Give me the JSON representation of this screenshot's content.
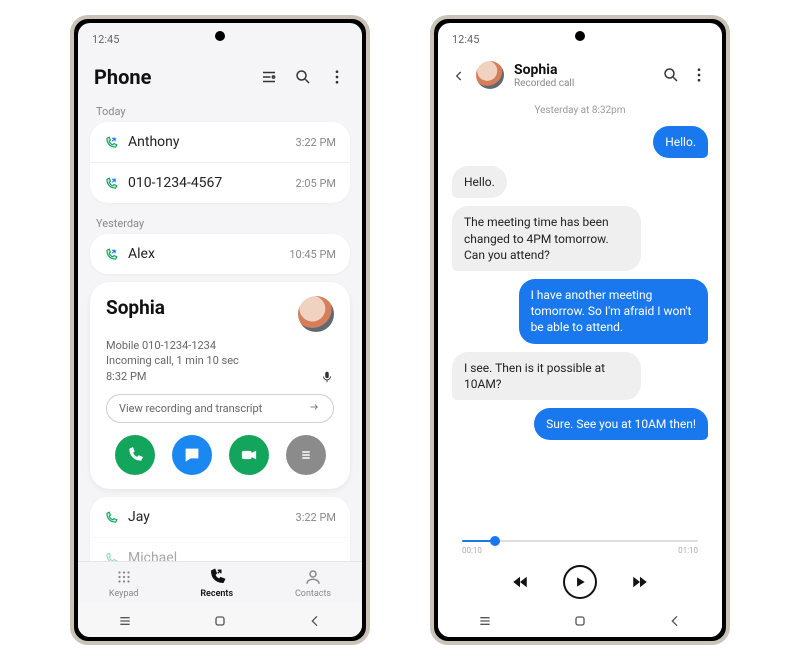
{
  "phone1": {
    "status_time": "12:45",
    "header": {
      "title": "Phone"
    },
    "sections": {
      "today_label": "Today",
      "yesterday_label": "Yesterday"
    },
    "today": [
      {
        "name": "Anthony",
        "time": "3:22 PM"
      },
      {
        "name": "010-1234-4567",
        "time": "2:05 PM"
      }
    ],
    "yesterday": [
      {
        "name": "Alex",
        "time": "10:45 PM"
      }
    ],
    "detail": {
      "name": "Sophia",
      "line1": "Mobile 010-1234-1234",
      "line2": "Incoming call, 1 min 10 sec",
      "line3": "8:32 PM",
      "transcript_btn": "View recording and transcript"
    },
    "more": [
      {
        "name": "Jay",
        "time": "3:22 PM"
      },
      {
        "name": "Michael",
        "time": ""
      }
    ],
    "tabs": {
      "keypad": "Keypad",
      "recents": "Recents",
      "contacts": "Contacts"
    }
  },
  "phone2": {
    "status_time": "12:45",
    "header": {
      "name": "Sophia",
      "sub": "Recorded call"
    },
    "timestamp": "Yesterday at 8:32pm",
    "messages": [
      {
        "side": "right",
        "text": "Hello."
      },
      {
        "side": "left",
        "text": "Hello."
      },
      {
        "side": "left",
        "text": "The meeting time has been changed to 4PM tomorrow. Can you attend?"
      },
      {
        "side": "right",
        "text": "I have another meeting tomorrow. So I'm afraid I won't be able to attend."
      },
      {
        "side": "left",
        "text": "I see. Then is it possible at 10AM?"
      },
      {
        "side": "right",
        "text": "Sure. See you at 10AM then!"
      }
    ],
    "player": {
      "elapsed": "00:10",
      "total": "01:10"
    }
  }
}
